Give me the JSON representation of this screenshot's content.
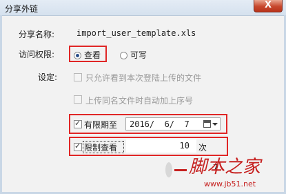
{
  "window": {
    "title": "分享外链",
    "close_glyph": "X"
  },
  "form": {
    "share_name_label": "分享名称:",
    "share_name_value": "import_user_template.xls",
    "access_label": "访问权限:",
    "access_options": [
      {
        "label": "查看",
        "checked": true
      },
      {
        "label": "可写",
        "checked": false
      }
    ],
    "settings_label": "设定:",
    "settings_options": [
      {
        "label": "只允许看到本次登陆上传的文件",
        "checked": false,
        "enabled": false
      },
      {
        "label": "上传同名文件时自动加上序号",
        "checked": false,
        "enabled": false
      }
    ],
    "expiry": {
      "label": "有限期至",
      "checked": true,
      "value": "2016/  6/  7"
    },
    "view_limit": {
      "label": "限制查看",
      "checked": true,
      "value": "10",
      "unit": "次"
    },
    "partial_text": "7"
  },
  "watermark": {
    "site_name": "脚本之家",
    "url": "www.jb51.net"
  },
  "colors": {
    "highlight_box": "#e02626",
    "watermark": "#c6201f"
  }
}
